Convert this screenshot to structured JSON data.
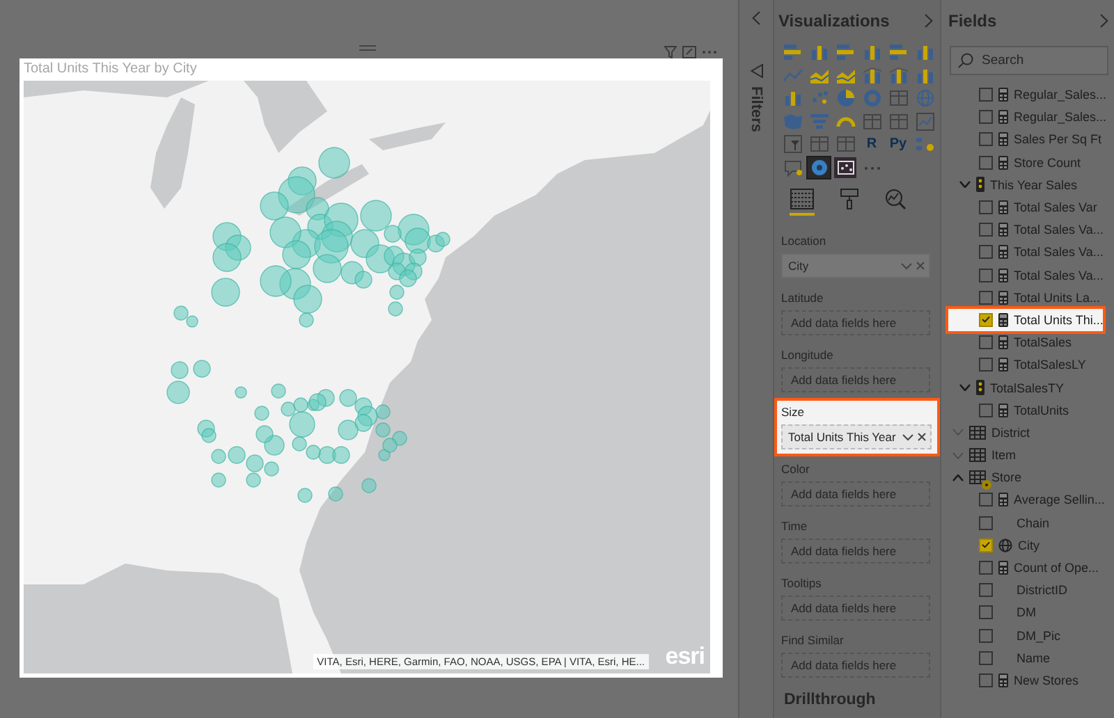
{
  "visual": {
    "title": "Total Units This Year by City",
    "attribution": "VITA, Esri, HERE, Garmin, FAO, NOAA, USGS, EPA | VITA, Esri, HE...",
    "logo": "esri"
  },
  "filters_pane": {
    "title": "Filters"
  },
  "visualizations": {
    "title": "Visualizations",
    "types": [
      {
        "kind": "stacked-bar",
        "selected": false
      },
      {
        "kind": "stacked-column",
        "selected": false
      },
      {
        "kind": "clustered-bar",
        "selected": false
      },
      {
        "kind": "clustered-column",
        "selected": false
      },
      {
        "kind": "bar100",
        "selected": false
      },
      {
        "kind": "column100",
        "selected": false
      },
      {
        "kind": "line",
        "selected": false
      },
      {
        "kind": "area",
        "selected": false
      },
      {
        "kind": "stacked-area",
        "selected": false
      },
      {
        "kind": "line-column",
        "selected": false
      },
      {
        "kind": "line-column",
        "selected": false
      },
      {
        "kind": "ribbon",
        "selected": false
      },
      {
        "kind": "waterfall",
        "selected": false
      },
      {
        "kind": "scatter",
        "selected": false
      },
      {
        "kind": "pie",
        "selected": false
      },
      {
        "kind": "donut",
        "selected": false
      },
      {
        "kind": "treemap",
        "selected": false
      },
      {
        "kind": "globe",
        "selected": false
      },
      {
        "kind": "filled-map",
        "selected": false
      },
      {
        "kind": "funnel",
        "selected": false
      },
      {
        "kind": "gauge",
        "selected": false
      },
      {
        "kind": "card",
        "selected": false
      },
      {
        "kind": "multi-card",
        "selected": false
      },
      {
        "kind": "kpi",
        "selected": false
      },
      {
        "kind": "slicer",
        "selected": false
      },
      {
        "kind": "table",
        "selected": false
      },
      {
        "kind": "matrix",
        "selected": false
      },
      {
        "kind": "text",
        "label": "R",
        "selected": false
      },
      {
        "kind": "text",
        "label": "Py",
        "selected": false
      },
      {
        "kind": "influencers",
        "selected": false
      },
      {
        "kind": "qa",
        "selected": false
      },
      {
        "kind": "arcgis",
        "selected": true
      },
      {
        "kind": "custom",
        "selected": false
      },
      {
        "kind": "more",
        "selected": false
      }
    ],
    "pane_tabs": [
      {
        "kind": "fields",
        "selected": true
      },
      {
        "kind": "format",
        "selected": false
      },
      {
        "kind": "analytics",
        "selected": false
      }
    ],
    "wells": [
      {
        "label": "Location",
        "field": "City",
        "highlighted": false
      },
      {
        "label": "Latitude",
        "hint": "Add data fields here",
        "highlighted": false
      },
      {
        "label": "Longitude",
        "hint": "Add data fields here",
        "highlighted": false
      },
      {
        "label": "Size",
        "field": "Total Units This Year",
        "highlighted": true
      },
      {
        "label": "Color",
        "hint": "Add data fields here",
        "highlighted": false
      },
      {
        "label": "Time",
        "hint": "Add data fields here",
        "highlighted": false
      },
      {
        "label": "Tooltips",
        "hint": "Add data fields here",
        "highlighted": false
      },
      {
        "label": "Find Similar",
        "hint": "Add data fields here",
        "highlighted": false
      }
    ],
    "drillthrough": "Drillthrough"
  },
  "fields": {
    "title": "Fields",
    "search": {
      "placeholder": "Search"
    },
    "items": [
      {
        "kind": "measure",
        "label": "Regular_Sales...",
        "checked": false,
        "highlighted": false
      },
      {
        "kind": "measure",
        "label": "Regular_Sales...",
        "checked": false,
        "highlighted": false
      },
      {
        "kind": "measure",
        "label": "Sales Per Sq Ft",
        "checked": false,
        "highlighted": false
      },
      {
        "kind": "measure",
        "label": "Store Count",
        "checked": false,
        "highlighted": false
      },
      {
        "kind": "group",
        "label": "This Year Sales",
        "expanded": true,
        "children": [
          {
            "kind": "measure",
            "label": "Total Sales Var",
            "checked": false,
            "highlighted": false
          },
          {
            "kind": "measure",
            "label": "Total Sales Va...",
            "checked": false,
            "highlighted": false
          },
          {
            "kind": "measure",
            "label": "Total Sales Va...",
            "checked": false,
            "highlighted": false
          },
          {
            "kind": "measure",
            "label": "Total Sales Va...",
            "checked": false,
            "highlighted": false
          },
          {
            "kind": "measure",
            "label": "Total Units La...",
            "checked": false,
            "highlighted": false
          },
          {
            "kind": "measure",
            "label": "Total Units Thi...",
            "checked": true,
            "highlighted": true
          },
          {
            "kind": "measure",
            "label": "TotalSales",
            "checked": false,
            "highlighted": false
          },
          {
            "kind": "measure",
            "label": "TotalSalesLY",
            "checked": false,
            "highlighted": false
          }
        ]
      },
      {
        "kind": "group",
        "label": "TotalSalesTY",
        "expanded": true,
        "children": [
          {
            "kind": "measure",
            "label": "TotalUnits",
            "checked": false,
            "highlighted": false
          }
        ]
      },
      {
        "kind": "table",
        "label": "District",
        "expanded": false,
        "in_use": false
      },
      {
        "kind": "table",
        "label": "Item",
        "expanded": false,
        "in_use": false
      },
      {
        "kind": "table",
        "label": "Store",
        "expanded": true,
        "in_use": true,
        "children": [
          {
            "kind": "measure",
            "label": "Average Sellin...",
            "checked": false,
            "highlighted": false
          },
          {
            "kind": "field",
            "label": "Chain",
            "checked": false,
            "highlighted": false
          },
          {
            "kind": "geo",
            "label": "City",
            "checked": true,
            "highlighted": false
          },
          {
            "kind": "measure",
            "label": "Count of Ope...",
            "checked": false,
            "highlighted": false
          },
          {
            "kind": "field",
            "label": "DistrictID",
            "checked": false,
            "highlighted": false
          },
          {
            "kind": "field",
            "label": "DM",
            "checked": false,
            "highlighted": false
          },
          {
            "kind": "field",
            "label": "DM_Pic",
            "checked": false,
            "highlighted": false
          },
          {
            "kind": "field",
            "label": "Name",
            "checked": false,
            "highlighted": false
          },
          {
            "kind": "measure",
            "label": "New Stores",
            "checked": false,
            "highlighted": false
          }
        ]
      }
    ]
  }
}
